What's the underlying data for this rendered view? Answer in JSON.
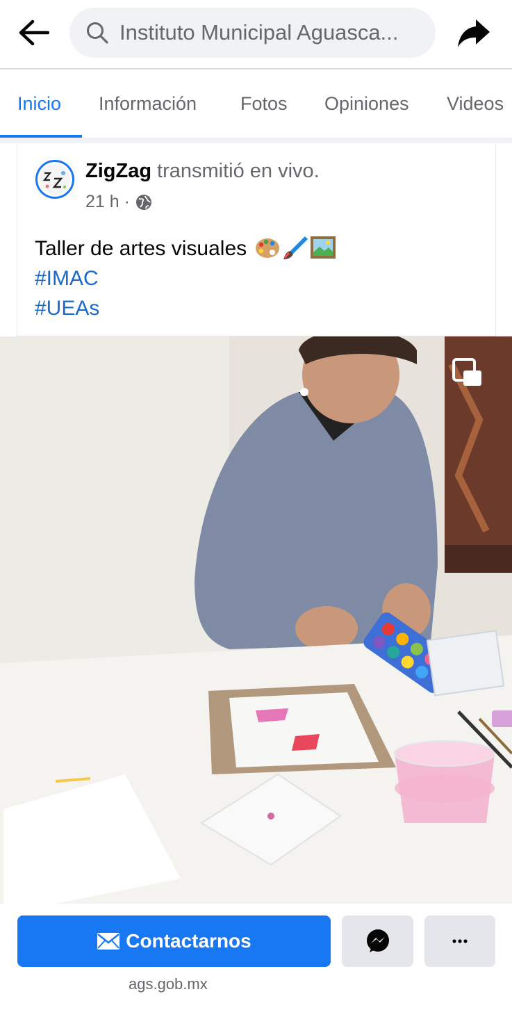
{
  "search": {
    "placeholder": "Instituto Municipal Aguascalientes para la Cultura",
    "value": "Instituto Municipal Aguasca..."
  },
  "tabs": [
    {
      "label": "Inicio",
      "active": true
    },
    {
      "label": "Información",
      "active": false
    },
    {
      "label": "Fotos",
      "active": false
    },
    {
      "label": "Opiniones",
      "active": false
    },
    {
      "label": "Videos",
      "active": false
    }
  ],
  "post": {
    "author": "ZigZag",
    "action": "transmitió en vivo.",
    "time": "21 h ·",
    "text": "Taller de artes visuales",
    "emojis": [
      "palette-emoji",
      "paintbrush-emoji",
      "framed-picture-emoji"
    ],
    "hashtags": [
      "#IMAC",
      "#UEAs"
    ],
    "avatar_text": "ZigZag"
  },
  "video": {
    "description_icon": "picture-in-picture-icon"
  },
  "actions": {
    "contact_label": "Contactarnos",
    "website": "ags.gob.mx"
  },
  "colors": {
    "accent": "#1877f2",
    "hashtag": "#1b6ac9",
    "muted": "#65676b",
    "button_gray": "#e4e6eb"
  }
}
